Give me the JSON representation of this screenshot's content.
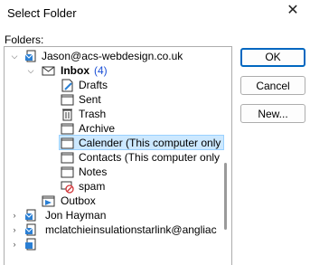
{
  "dialog": {
    "title": "Select Folder",
    "close_symbol": "✕",
    "folders_label": "Folders:"
  },
  "buttons": {
    "ok": "OK",
    "cancel": "Cancel",
    "new": "New..."
  },
  "tree": [
    {
      "label": "Jason@acs-webdesign.co.uk",
      "icon": "account-icon",
      "expanded": true
    },
    {
      "label": "Inbox",
      "count": "(4)",
      "icon": "inbox-icon",
      "expanded": true,
      "bold": true
    },
    {
      "label": "Drafts",
      "icon": "drafts-icon"
    },
    {
      "label": "Sent",
      "icon": "sent-icon"
    },
    {
      "label": "Trash",
      "icon": "trash-icon"
    },
    {
      "label": "Archive",
      "icon": "archive-icon"
    },
    {
      "label": "Calender (This computer only",
      "icon": "calendar-folder-icon",
      "selected": true
    },
    {
      "label": "Contacts (This computer only",
      "icon": "contacts-folder-icon"
    },
    {
      "label": "Notes",
      "icon": "notes-icon"
    },
    {
      "label": "spam",
      "icon": "spam-icon"
    },
    {
      "label": "Outbox",
      "icon": "outbox-icon"
    },
    {
      "label": "Jon Hayman",
      "icon": "account-icon"
    },
    {
      "label": "mclatchieinsulationstarlink@angliac",
      "icon": "account-icon"
    }
  ]
}
